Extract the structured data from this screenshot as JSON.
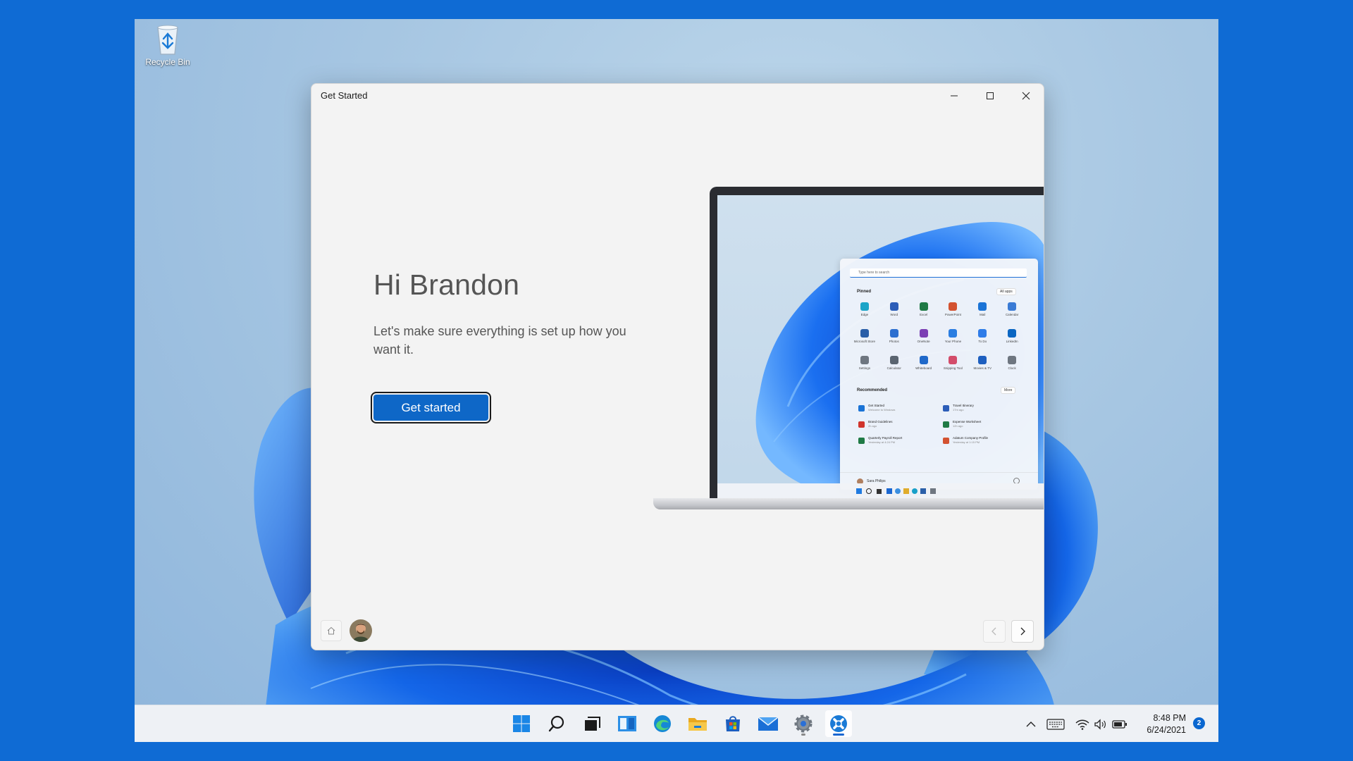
{
  "desktop": {
    "recycle_bin_label": "Recycle Bin"
  },
  "window": {
    "title": "Get Started",
    "greeting": "Hi Brandon",
    "subtitle": "Let's make sure everything is set up how you want it.",
    "primary_button": "Get started",
    "accent_color": "#0e67c7"
  },
  "mockup": {
    "search_placeholder": "Type here to search",
    "pinned_heading": "Pinned",
    "all_apps_label": "All apps",
    "recommended_heading": "Recommended",
    "more_label": "More",
    "user_name": "Sara Philips",
    "pinned_apps": [
      {
        "name": "Edge",
        "color": "#1aa4c8"
      },
      {
        "name": "Word",
        "color": "#2b5db8"
      },
      {
        "name": "Excel",
        "color": "#1f7a45"
      },
      {
        "name": "PowerPoint",
        "color": "#d35230"
      },
      {
        "name": "Mail",
        "color": "#1a73d6"
      },
      {
        "name": "Calendar",
        "color": "#3a7bd5"
      },
      {
        "name": "Microsoft Store",
        "color": "#2a5fa8"
      },
      {
        "name": "Photos",
        "color": "#2d6fd0"
      },
      {
        "name": "OneNote",
        "color": "#7b3fb4"
      },
      {
        "name": "Your Phone",
        "color": "#2a7de1"
      },
      {
        "name": "To Do",
        "color": "#2e7ce8"
      },
      {
        "name": "LinkedIn",
        "color": "#0a66c2"
      },
      {
        "name": "Settings",
        "color": "#6e7680"
      },
      {
        "name": "Calculator",
        "color": "#5a6470"
      },
      {
        "name": "Whiteboard",
        "color": "#1f68c9"
      },
      {
        "name": "Snipping Tool",
        "color": "#d34c6a"
      },
      {
        "name": "Movies & TV",
        "color": "#1d5fbf"
      },
      {
        "name": "Clock",
        "color": "#6e7680"
      }
    ],
    "recommended": [
      {
        "name": "Get Started",
        "sub": "Welcome to Windows",
        "color": "#1a73d6"
      },
      {
        "name": "Travel Itinerary",
        "sub": "17m ago",
        "color": "#2b5db8"
      },
      {
        "name": "Brand Guidelines",
        "sub": "2h ago",
        "color": "#d0342c"
      },
      {
        "name": "Expense Worksheet",
        "sub": "12h ago",
        "color": "#1f7a45"
      },
      {
        "name": "Quarterly Payroll Report",
        "sub": "Yesterday at 4:24 PM",
        "color": "#1f7a45"
      },
      {
        "name": "Adatum Company Profile",
        "sub": "Yesterday at 1:15 PM",
        "color": "#d35230"
      }
    ]
  },
  "taskbar": {
    "time": "8:48 PM",
    "date": "6/24/2021",
    "notification_count": "2"
  }
}
